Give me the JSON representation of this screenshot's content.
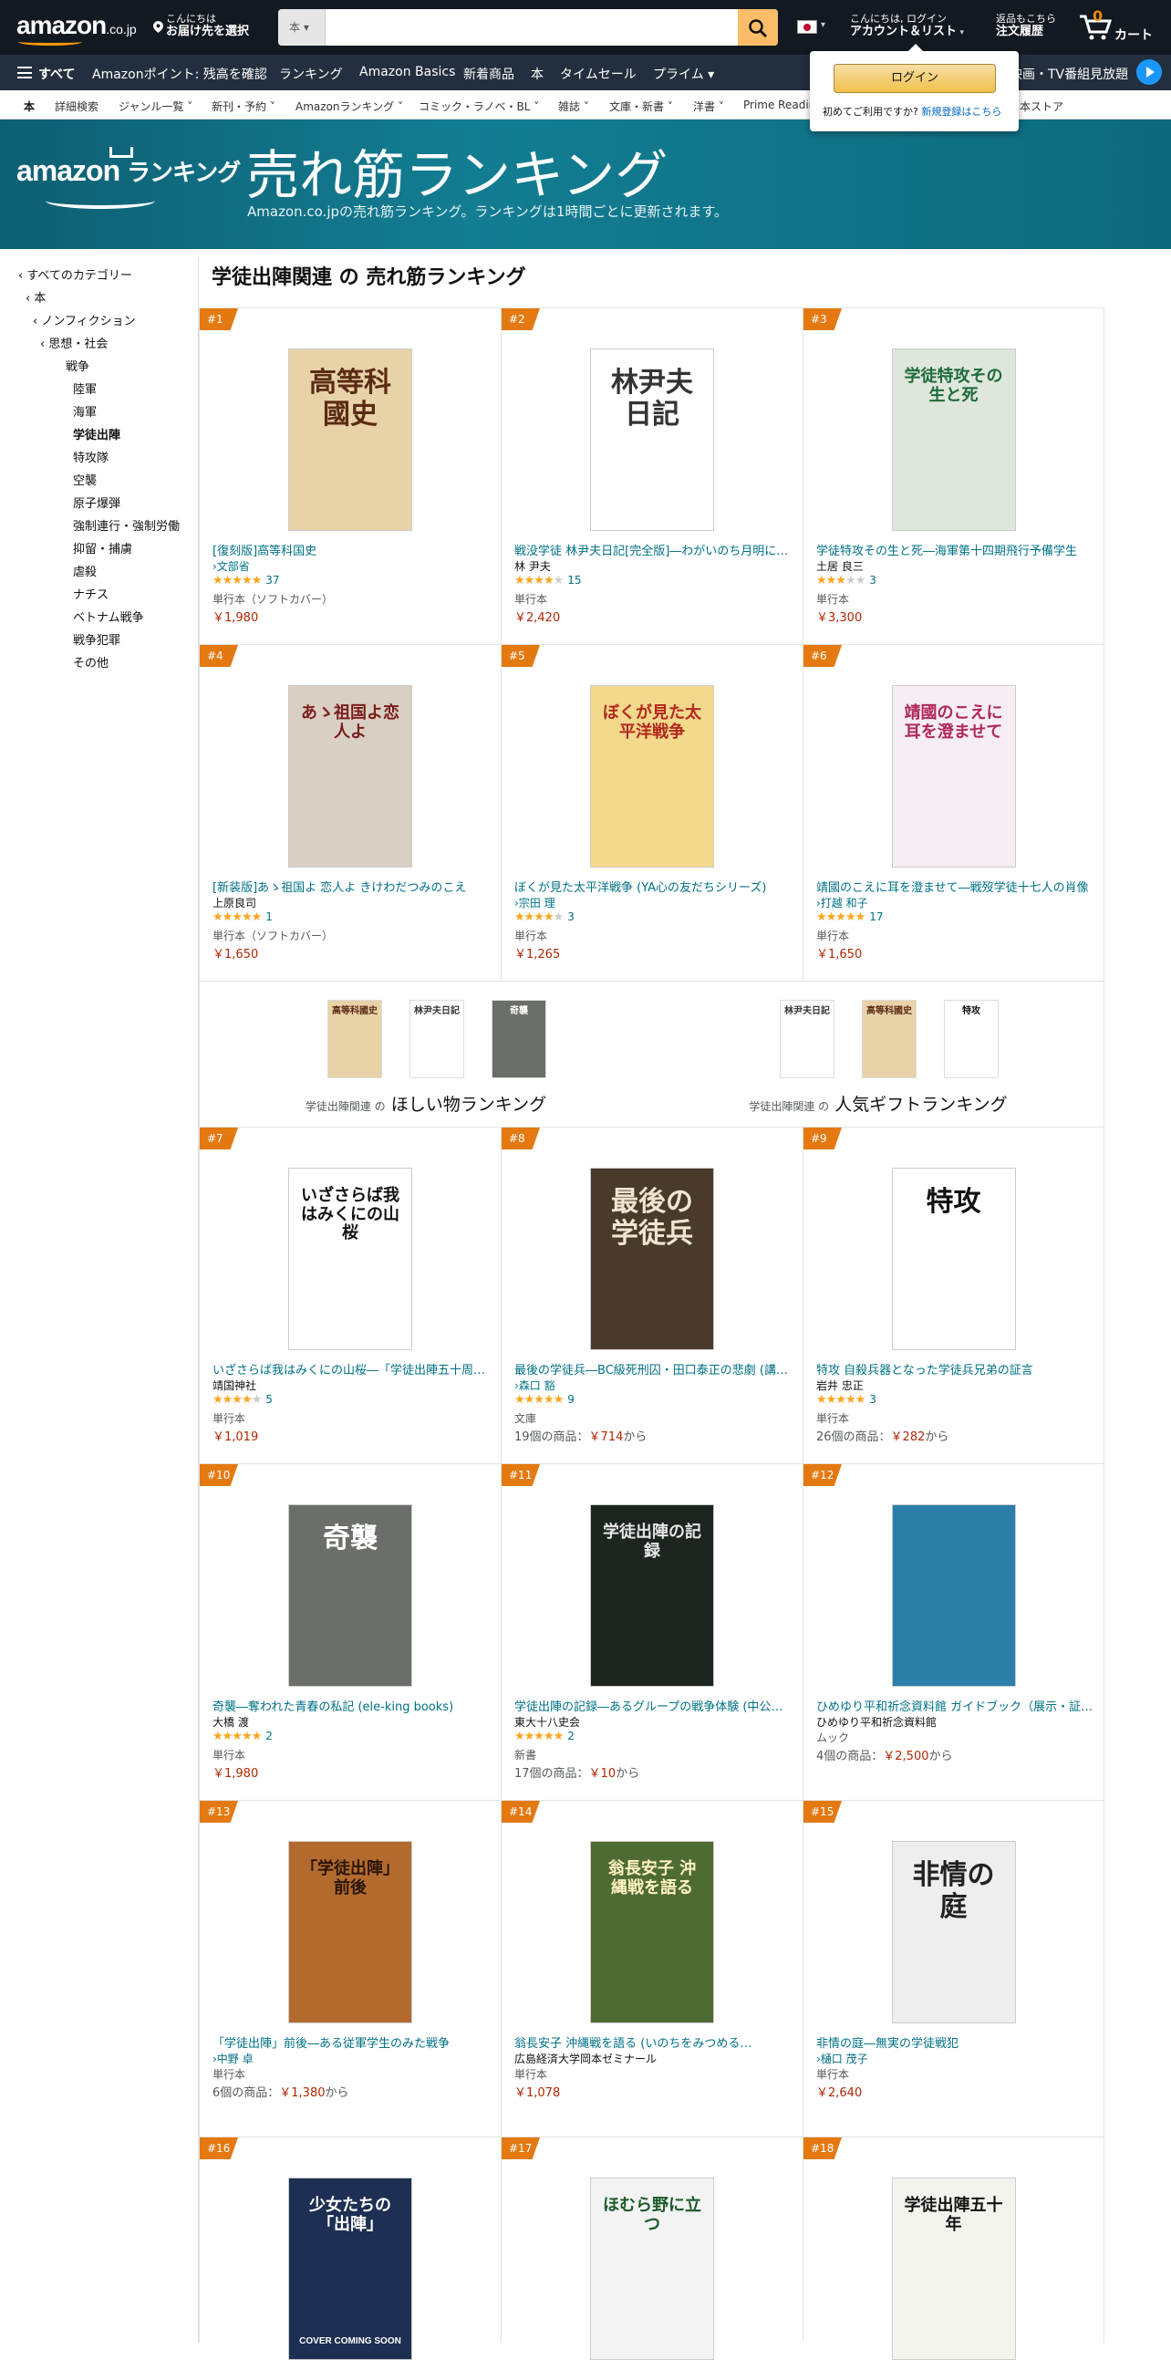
{
  "header": {
    "logo": "amazon",
    "logo_suffix": ".co.jp",
    "deliver_line1": "こんにちは",
    "deliver_line2": "お届け先を選択",
    "search_category": "本",
    "search_placeholder": "",
    "account_line1": "こんにちは, ログイン",
    "account_line2": "アカウント＆リスト",
    "orders_line1": "返品もこちら",
    "orders_line2": "注文履歴",
    "cart_count": "0",
    "cart_label": "カート"
  },
  "nav": {
    "all": "すべて",
    "items": [
      "Amazonポイント: 残高を確認",
      "ランキング",
      "Amazon Basics",
      "新着商品",
      "本",
      "タイムセール",
      "プライム"
    ],
    "right": "映画・TV番組見放題"
  },
  "subnav": {
    "items": [
      "本",
      "詳細検索",
      "ジャンル一覧",
      "新刊・予約",
      "Amazonランキング",
      "コミック・ラノベ・BL",
      "雑誌",
      "文庫・新書",
      "洋書",
      "Prime Readin",
      "本ストア"
    ]
  },
  "signin_popup": {
    "button": "ログイン",
    "text": "初めてご利用ですか?",
    "link": "新規登録はこちら"
  },
  "banner": {
    "logo": "amazon",
    "logo_suffix": "ランキング",
    "title": "売れ筋ランキング",
    "subtitle": "Amazon.co.jpの売れ筋ランキング。ランキングは1時間ごとに更新されます。"
  },
  "sidebar": {
    "items": [
      {
        "label": "‹ すべてのカテゴリー",
        "indent": 0
      },
      {
        "label": "‹ 本",
        "indent": 1
      },
      {
        "label": "‹ ノンフィクション",
        "indent": 2
      },
      {
        "label": "‹ 思想・社会",
        "indent": 3
      },
      {
        "label": "戦争",
        "indent": 4
      },
      {
        "label": "陸軍",
        "indent": 5
      },
      {
        "label": "海軍",
        "indent": 5
      },
      {
        "label": "学徒出陣",
        "indent": 5,
        "selected": true
      },
      {
        "label": "特攻隊",
        "indent": 5
      },
      {
        "label": "空襲",
        "indent": 5
      },
      {
        "label": "原子爆弾",
        "indent": 5
      },
      {
        "label": "強制連行・強制労働",
        "indent": 5
      },
      {
        "label": "抑留・捕虜",
        "indent": 5
      },
      {
        "label": "虐殺",
        "indent": 5
      },
      {
        "label": "ナチス",
        "indent": 5
      },
      {
        "label": "ベトナム戦争",
        "indent": 5
      },
      {
        "label": "戦争犯罪",
        "indent": 5
      },
      {
        "label": "その他",
        "indent": 5
      }
    ]
  },
  "page_title": "学徒出陣関連 の 売れ筋ランキング",
  "gift_sections": [
    {
      "prefix": "学徒出陣関連 の",
      "label": "ほしい物ランキング"
    },
    {
      "prefix": "学徒出陣関連 の",
      "label": "人気ギフトランキング"
    }
  ],
  "products": [
    {
      "rank": "#1",
      "title": "[復刻版]高等科国史",
      "author": "›文部省",
      "author_link": true,
      "stars": 4.5,
      "reviews": "37",
      "format": "単行本（ソフトカバー）",
      "price": "￥1,980",
      "cover": {
        "bg": "#e8d2a8",
        "fg": "#5a2b14",
        "text": "高等科國史"
      }
    },
    {
      "rank": "#2",
      "title": "戦没学徒 林尹夫日記[完全版]―わがいのち月明に燃ゆ",
      "author": "林 尹夫",
      "author_link": false,
      "stars": 4.0,
      "reviews": "15",
      "format": "単行本",
      "price": "￥2,420",
      "cover": {
        "bg": "#ffffff",
        "fg": "#333333",
        "text": "林尹夫日記"
      }
    },
    {
      "rank": "#3",
      "title": "学徒特攻その生と死―海軍第十四期飛行予備学生",
      "author": "土居 良三",
      "author_link": false,
      "stars": 3.0,
      "reviews": "3",
      "format": "単行本",
      "price": "￥3,300",
      "cover": {
        "bg": "#dfe6dc",
        "fg": "#1d6b3a",
        "text": "学徒特攻その生と死"
      }
    },
    {
      "rank": "#4",
      "title": "[新装版]あゝ祖国よ 恋人よ きけわだつみのこえ",
      "author": "上原良司",
      "author_link": false,
      "stars": 5.0,
      "reviews": "1",
      "format": "単行本（ソフトカバー）",
      "price": "￥1,650",
      "cover": {
        "bg": "#d9cfc2",
        "fg": "#7a1d1d",
        "text": "あゝ祖国よ恋人よ"
      }
    },
    {
      "rank": "#5",
      "title": "ぼくが見た太平洋戦争 (YA心の友だちシリーズ)",
      "author": "›宗田 理",
      "author_link": true,
      "stars": 4.0,
      "reviews": "3",
      "format": "単行本",
      "price": "￥1,265",
      "cover": {
        "bg": "#f2d98c",
        "fg": "#b3261e",
        "text": "ぼくが見た太平洋戦争"
      }
    },
    {
      "rank": "#6",
      "title": "靖國のこえに耳を澄ませて―戦歿学徒十七人の肖像",
      "author": "›打越 和子",
      "author_link": true,
      "stars": 4.5,
      "reviews": "17",
      "format": "単行本",
      "price": "￥1,650",
      "cover": {
        "bg": "#f6eef2",
        "fg": "#b0285a",
        "text": "靖國のこえに耳を澄ませて"
      }
    },
    {
      "rank": "#7",
      "title": "いざさらば我はみくにの山桜―「学徒出陣五十周年」",
      "author": "靖国神社",
      "author_link": false,
      "stars": 4.0,
      "reviews": "5",
      "format": "単行本",
      "price": "￥1,019",
      "cover": {
        "bg": "#ffffff",
        "fg": "#111111",
        "text": "いざさらば我はみくにの山桜"
      }
    },
    {
      "rank": "#8",
      "title": "最後の学徒兵―BC級死刑囚・田口泰正の悲劇 (講談社文庫)",
      "author": "›森口 豁",
      "author_link": true,
      "stars": 4.5,
      "reviews": "9",
      "format": "文庫",
      "price_pre": "19個の商品：",
      "price": "￥714",
      "price_post": "から",
      "cover": {
        "bg": "#4a3a2c",
        "fg": "#f0e6d0",
        "text": "最後の学徒兵"
      }
    },
    {
      "rank": "#9",
      "title": "特攻 自殺兵器となった学徒兵兄弟の証言",
      "author": "岩井 忠正",
      "author_link": false,
      "stars": 5.0,
      "reviews": "3",
      "format": "単行本",
      "price_pre": "26個の商品：",
      "price": "￥282",
      "price_post": "から",
      "cover": {
        "bg": "#ffffff",
        "fg": "#111111",
        "text": "特攻"
      }
    },
    {
      "rank": "#10",
      "title": "奇襲―奪われた青春の私記 (ele-king books)",
      "author": "大橋 渡",
      "author_link": false,
      "stars": 5.0,
      "reviews": "2",
      "format": "単行本",
      "price": "￥1,980",
      "cover": {
        "bg": "#6b6f6a",
        "fg": "#ffffff",
        "text": "奇襲"
      }
    },
    {
      "rank": "#11",
      "title": "学徒出陣の記録―あるグループの戦争体験 (中公新書)",
      "author": "東大十八史会",
      "author_link": false,
      "stars": 4.5,
      "reviews": "2",
      "format": "新書",
      "price_pre": "17個の商品：",
      "price": "￥10",
      "price_post": "から",
      "cover": {
        "bg": "#1e2420",
        "fg": "#e6e6e6",
        "text": "学徒出陣の記録"
      }
    },
    {
      "rank": "#12",
      "title": "ひめゆり平和祈念資料館 ガイドブック（展示・証言）",
      "author": "ひめゆり平和祈念資料館",
      "author_link": false,
      "stars": 0,
      "reviews": "",
      "format": "ムック",
      "price_pre": "4個の商品：",
      "price": "￥2,500",
      "price_post": "から",
      "cover": {
        "bg": "#2a7ea8",
        "fg": "#dbeef7",
        "text": ""
      }
    },
    {
      "rank": "#13",
      "title": "「学徒出陣」前後―ある従軍学生のみた戦争",
      "author": "›中野 卓",
      "author_link": true,
      "stars": 0,
      "reviews": "",
      "format": "単行本",
      "price_pre": "6個の商品：",
      "price": "￥1,380",
      "price_post": "から",
      "cover": {
        "bg": "#b36a2e",
        "fg": "#2b1508",
        "text": "「学徒出陣」前後"
      }
    },
    {
      "rank": "#14",
      "title": "翁長安子 沖縄戦を語る (いのちをみつめる…",
      "author": "広島経済大学岡本ゼミナール",
      "author_link": false,
      "stars": 0,
      "reviews": "",
      "format": "単行本",
      "price": "￥1,078",
      "cover": {
        "bg": "#4f6b34",
        "fg": "#fff4c2",
        "text": "翁長安子 沖縄戦を語る"
      }
    },
    {
      "rank": "#15",
      "title": "非情の庭―無実の学徒戦犯",
      "author": "›樋口 茂子",
      "author_link": true,
      "stars": 0,
      "reviews": "",
      "format": "単行本",
      "price": "￥2,640",
      "cover": {
        "bg": "#eeeeee",
        "fg": "#222222",
        "text": "非情の庭"
      }
    },
    {
      "rank": "#16",
      "title": "",
      "author": "",
      "author_link": false,
      "stars": 0,
      "reviews": "",
      "format": "",
      "price": "",
      "cover": {
        "bg": "#1d2f52",
        "fg": "#ffffff",
        "text": "少女たちの「出陣」",
        "coming": "COVER COMING SOON"
      }
    },
    {
      "rank": "#17",
      "title": "",
      "author": "",
      "author_link": false,
      "stars": 0,
      "reviews": "",
      "format": "",
      "price": "",
      "cover": {
        "bg": "#f3f3f3",
        "fg": "#1c5a2a",
        "text": "ほむら野に立つ"
      }
    },
    {
      "rank": "#18",
      "title": "",
      "author": "",
      "author_link": false,
      "stars": 0,
      "reviews": "",
      "format": "",
      "price": "",
      "cover": {
        "bg": "#f4f4ee",
        "fg": "#111111",
        "text": "学徒出陣五十年"
      }
    }
  ],
  "colors": {
    "navy": "#131921",
    "nav2": "#232f3e",
    "orange": "#e47911",
    "link": "#007185",
    "price": "#b12704",
    "star": "#ffa41c",
    "banner": "#137d92"
  }
}
